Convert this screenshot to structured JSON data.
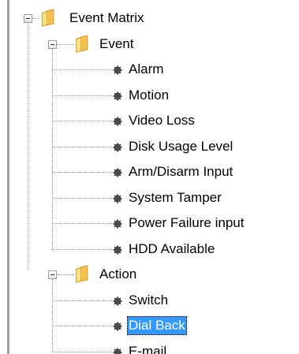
{
  "tree": {
    "root": {
      "label": "Event Matrix",
      "expanded": true,
      "children": [
        {
          "label": "Event",
          "expanded": true,
          "items": [
            "Alarm",
            "Motion",
            "Video Loss",
            "Disk Usage Level",
            "Arm/Disarm Input",
            "System Tamper",
            "Power Failure input",
            "HDD Available"
          ]
        },
        {
          "label": "Action",
          "expanded": true,
          "items": [
            "Switch",
            "Dial Back",
            "E-mail"
          ],
          "selected_item": "Dial Back"
        }
      ]
    }
  },
  "colors": {
    "selection_background": "#3399ff",
    "selection_text": "#ffffff",
    "folder_yellow": "#f2c14e"
  },
  "icons": {
    "folder": "folder-icon",
    "leaf": "bullet-icon",
    "expander": "collapse-toggle-icon"
  }
}
